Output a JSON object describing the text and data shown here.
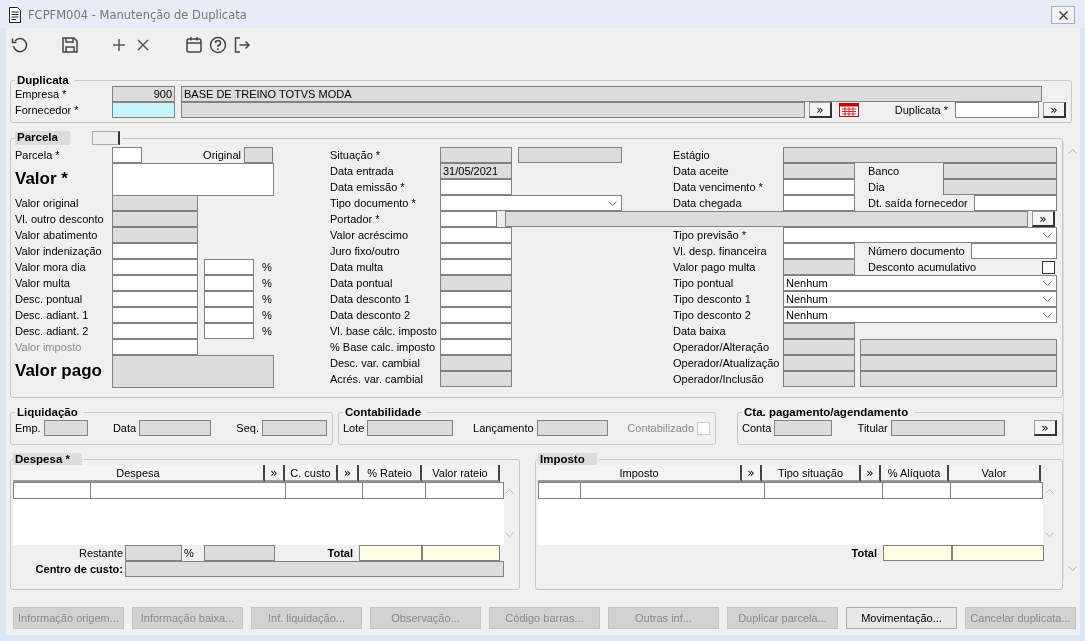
{
  "window": {
    "title": "FCPFM004 - Manutenção de Duplicata"
  },
  "duplicata": {
    "title": "Duplicata",
    "empresa": {
      "label": "Empresa *",
      "code": "900",
      "name": "BASE DE TREINO TOTVS MODA"
    },
    "fornecedor": {
      "label": "Fornecedor *",
      "focused": true,
      "button": "»"
    },
    "duplicata": {
      "label": "Duplicata *",
      "button": "»"
    }
  },
  "parcela": {
    "title": "Parcela",
    "left": [
      {
        "kind": "pair",
        "label": "Parcela *",
        "disabled": false,
        "label2": "Original",
        "disabled2": true
      },
      {
        "kind": "big",
        "label": "Valor *",
        "disabled": false
      },
      {
        "kind": "field",
        "label": "Valor original",
        "disabled": true
      },
      {
        "kind": "field",
        "label": "Vl. outro desconto",
        "disabled": true
      },
      {
        "kind": "field",
        "label": "Valor abatimento",
        "disabled": true
      },
      {
        "kind": "field",
        "label": "Valor indenização",
        "disabled": false
      },
      {
        "kind": "pct",
        "label": "Valor mora dia",
        "disabled": false,
        "unit": "%"
      },
      {
        "kind": "pct",
        "label": "Valor multa",
        "disabled": false,
        "unit": "%"
      },
      {
        "kind": "pct",
        "label": "Desc. pontual",
        "disabled": false,
        "unit": "%"
      },
      {
        "kind": "pct",
        "label": "Desc. adiant. 1",
        "disabled": false,
        "unit": "%"
      },
      {
        "kind": "pct",
        "label": "Desc. adiant. 2",
        "disabled": false,
        "unit": "%"
      },
      {
        "kind": "field",
        "label": "Valor imposto",
        "disabled": false,
        "label_disabled": true
      },
      {
        "kind": "big",
        "label": "Valor pago",
        "disabled": true
      }
    ],
    "middle": [
      {
        "kind": "double",
        "label": "Situação *",
        "disabled": true,
        "disabled2": true
      },
      {
        "kind": "field",
        "label": "Data entrada",
        "disabled": true,
        "value": "31/05/2021"
      },
      {
        "kind": "field",
        "label": "Data emissão *",
        "disabled": false
      },
      {
        "kind": "select",
        "label": "Tipo documento *"
      },
      {
        "kind": "lookup",
        "label": "Portador *",
        "disabled": false,
        "disabled2": true,
        "button": "»"
      },
      {
        "kind": "field",
        "label": "Valor acréscimo",
        "disabled": false
      },
      {
        "kind": "field",
        "label": "Juro fixo/outro",
        "disabled": false
      },
      {
        "kind": "field",
        "label": "Data multa",
        "disabled": false
      },
      {
        "kind": "field",
        "label": "Data pontual",
        "disabled": true
      },
      {
        "kind": "field",
        "label": "Data desconto 1",
        "disabled": false
      },
      {
        "kind": "field",
        "label": "Data desconto 2",
        "disabled": false
      },
      {
        "kind": "field",
        "label": "Vl. base cálc. imposto",
        "disabled": false
      },
      {
        "kind": "field",
        "label": "% Base calc. imposto",
        "disabled": false
      },
      {
        "kind": "field",
        "label": "Desc. var. cambial",
        "disabled": true
      },
      {
        "kind": "field",
        "label": "Acrés. var. cambial",
        "disabled": true
      }
    ],
    "right": [
      {
        "kind": "wide",
        "label": "Estágio",
        "disabled": true
      },
      {
        "kind": "pair",
        "label": "Data aceite",
        "disabled": true,
        "label2": "Banco",
        "disabled2": true
      },
      {
        "kind": "pair",
        "label": "Data vencimento *",
        "disabled": false,
        "label2": "Dia",
        "disabled2": true
      },
      {
        "kind": "pair",
        "label": "Data chegada",
        "disabled": false,
        "label2": "Dt. saída fornecedor",
        "disabled2": false
      },
      {
        "kind": "select",
        "label": "Tipo previsão *"
      },
      {
        "kind": "pair",
        "label": "Vl. desp. financeira",
        "disabled": false,
        "label2": "Número documento",
        "disabled2": false
      },
      {
        "kind": "check",
        "label": "Valor pago multa",
        "disabled": true,
        "label2": "Desconto acumulativo",
        "checked": false
      },
      {
        "kind": "select",
        "label": "Tipo pontual",
        "value": "Nenhum"
      },
      {
        "kind": "select",
        "label": "Tipo desconto 1",
        "value": "Nenhum"
      },
      {
        "kind": "select",
        "label": "Tipo desconto 2",
        "value": "Nenhum"
      },
      {
        "kind": "field",
        "label": "Data baixa",
        "disabled": true
      },
      {
        "kind": "double",
        "label": "Operador/Alteração",
        "disabled": true,
        "disabled2": true
      },
      {
        "kind": "double",
        "label": "Operador/Atualização",
        "disabled": true,
        "disabled2": true
      },
      {
        "kind": "double",
        "label": "Operador/Inclusão",
        "disabled": true,
        "disabled2": true
      }
    ]
  },
  "liquidacao": {
    "title": "Liquidação",
    "fields": [
      {
        "label": "Emp.",
        "disabled": true
      },
      {
        "label": "Data",
        "disabled": true
      },
      {
        "label": "Seq.",
        "disabled": true
      }
    ]
  },
  "contabilidade": {
    "title": "Contabilidade",
    "fields": [
      {
        "kind": "field",
        "label": "Lote",
        "disabled": true
      },
      {
        "kind": "field",
        "label": "Lançamento",
        "disabled": true
      },
      {
        "kind": "check",
        "label": "Contabilizado",
        "disabled": true,
        "checked": false
      }
    ]
  },
  "cta_pagamento": {
    "title": "Cta. pagamento/agendamento",
    "fields": [
      {
        "label": "Conta",
        "disabled": true
      },
      {
        "label": "Titular",
        "disabled": true
      }
    ],
    "button": "»"
  },
  "despesa": {
    "title": "Despesa *",
    "columns": [
      {
        "kind": "header",
        "label": "Despesa"
      },
      {
        "kind": "button",
        "label": "»"
      },
      {
        "kind": "header",
        "label": "C. custo"
      },
      {
        "kind": "button",
        "label": "»"
      },
      {
        "kind": "header",
        "label": "% Rateio"
      },
      {
        "kind": "header",
        "label": "Valor rateio"
      }
    ],
    "restante_label": "Restante",
    "percent_label": "%",
    "total_label": "Total",
    "centro_label": "Centro de custo:"
  },
  "imposto": {
    "title": "Imposto",
    "columns": [
      {
        "kind": "header",
        "label": "Imposto"
      },
      {
        "kind": "button",
        "label": "»"
      },
      {
        "kind": "header",
        "label": "Tipo situação"
      },
      {
        "kind": "button",
        "label": "»"
      },
      {
        "kind": "header",
        "label": "% Alíquota"
      },
      {
        "kind": "header",
        "label": "Valor"
      }
    ],
    "total_label": "Total"
  },
  "buttons": [
    {
      "label": "Informação origem...",
      "disabled": true
    },
    {
      "label": "Informação baixa...",
      "disabled": true
    },
    {
      "label": "Inf. liquidação...",
      "disabled": true
    },
    {
      "label": "Observação...",
      "disabled": true
    },
    {
      "label": "Código barras...",
      "disabled": true
    },
    {
      "label": "Outras inf...",
      "disabled": true
    },
    {
      "label": "Duplicar parcela...",
      "disabled": true
    },
    {
      "label": "Movimentação...",
      "disabled": false
    },
    {
      "label": "Cancelar duplicata...",
      "disabled": true
    }
  ]
}
